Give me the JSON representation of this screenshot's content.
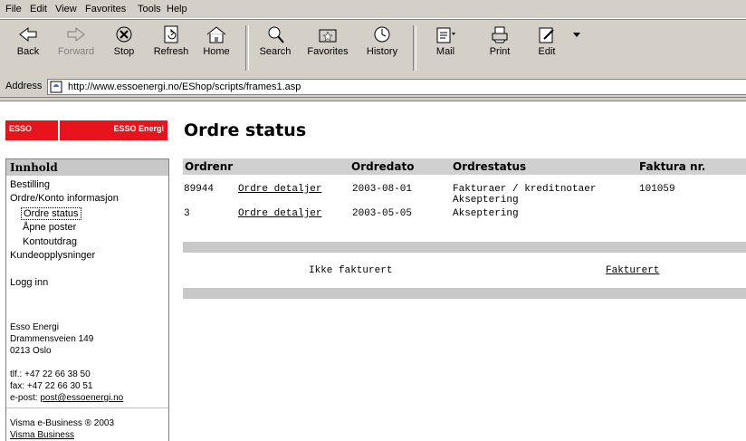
{
  "menu": [
    "File",
    "Edit",
    "View",
    "Favorites",
    "Tools",
    "Help"
  ],
  "toolbar": {
    "back": "Back",
    "forward": "Forward",
    "stop": "Stop",
    "refresh": "Refresh",
    "home": "Home",
    "search": "Search",
    "favorites": "Favorites",
    "history": "History",
    "mail": "Mail",
    "print": "Print",
    "edit": "Edit"
  },
  "address": {
    "label": "Address",
    "url": "http://www.essoenergi.no/EShop/scripts/frames1.asp"
  },
  "logo": {
    "left": "ESSO",
    "right": "ESSO Energi"
  },
  "sidebar": {
    "heading": "Innhold",
    "items": [
      "Bestilling",
      "Ordre/Konto informasjon",
      "Ordre status",
      "Åpne poster",
      "Kontoutdrag",
      "Kundeopplysninger",
      "Logg inn"
    ],
    "company": "Esso Energi",
    "street": "Drammensveien 149",
    "city": "0213 Oslo",
    "phone": "tlf.: +47 22 66 38 50",
    "fax": "fax: +47 22 66 30 51",
    "email_prefix": "e-post: ",
    "email": "post@essoenergi.no",
    "footer": "Visma e-Business ® 2003",
    "footer_link": "Visma Business"
  },
  "main": {
    "title": "Ordre status",
    "columns": [
      "Ordrenr",
      "Ordredato",
      "Ordrestatus",
      "Faktura nr."
    ],
    "rows": [
      {
        "nr": "89944",
        "link": "Ordre detaljer",
        "date": "2003-08-01",
        "status1": "Fakturaer / kreditnotaer",
        "status2": "Akseptering",
        "invoice": "101059"
      },
      {
        "nr": "3",
        "link": "Ordre detaljer",
        "date": "2003-05-05",
        "status1": "Akseptering",
        "status2": "",
        "invoice": ""
      }
    ],
    "not_invoiced": "Ikke fakturert",
    "invoiced": "Fakturert"
  },
  "colors": {
    "logo_red": "#e8141b",
    "chrome": "#d4d0c8",
    "header_gray": "#d0d0d0"
  }
}
